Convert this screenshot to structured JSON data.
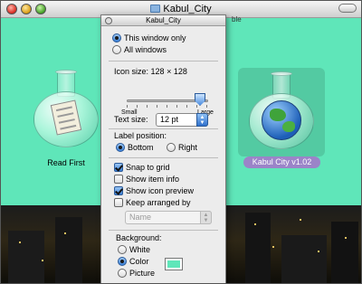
{
  "window": {
    "title": "Kabul_City",
    "behind_text": "ble",
    "background_color": "#5fe6b9"
  },
  "desktop_icons": [
    {
      "label": "Read First",
      "icon": "document-flask-icon"
    },
    {
      "label": "Kabul City v1.02",
      "icon": "globe-flask-icon",
      "selected": true
    }
  ],
  "palette": {
    "title": "Kabul_City",
    "scope": {
      "this_window_only": "This window only",
      "all_windows": "All windows",
      "selected": "this_window_only"
    },
    "icon_size": {
      "label": "Icon size:",
      "value": "128 × 128",
      "small": "Small",
      "large": "Large",
      "level": 0.9
    },
    "text_size": {
      "label": "Text size:",
      "value": "12 pt"
    },
    "label_position": {
      "label": "Label position:",
      "bottom": "Bottom",
      "right": "Right",
      "selected": "bottom"
    },
    "options": {
      "snap_to_grid": {
        "label": "Snap to grid",
        "checked": true
      },
      "show_item_info": {
        "label": "Show item info",
        "checked": false
      },
      "show_icon_preview": {
        "label": "Show icon preview",
        "checked": true
      },
      "keep_arranged_by": {
        "label": "Keep arranged by",
        "checked": false
      }
    },
    "arrange_select": {
      "value": "Name"
    },
    "background": {
      "label": "Background:",
      "white": "White",
      "color": "Color",
      "picture": "Picture",
      "selected": "color",
      "swatch_color": "#5fe6b9"
    }
  }
}
